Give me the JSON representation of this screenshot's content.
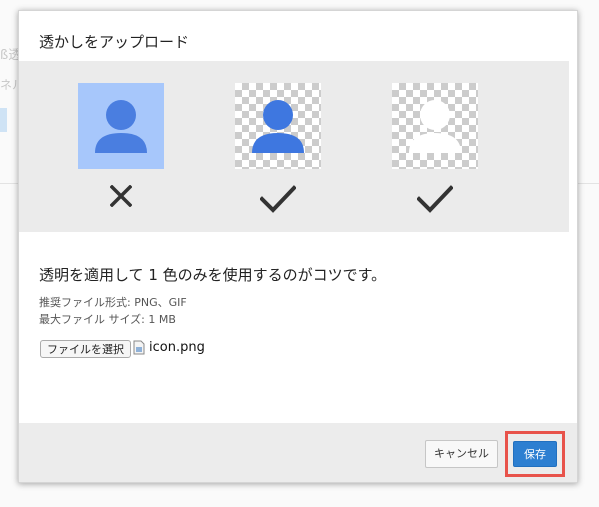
{
  "background": {
    "text_line1": "ß透",
    "text_line2": "ネル"
  },
  "dialog": {
    "title": "透かしをアップロード",
    "preview": {
      "examples": [
        {
          "style": "solid-background",
          "person_color": "#4a7ee0",
          "result": "bad",
          "result_icon": "cross-icon"
        },
        {
          "style": "transparent-background",
          "person_color": "#3e77e0",
          "result": "good",
          "result_icon": "check-icon"
        },
        {
          "style": "transparent-background",
          "person_color": "#ffffff",
          "result": "good",
          "result_icon": "check-icon"
        }
      ]
    },
    "tip": "透明を適用して 1 色のみを使用するのがコツです。",
    "recommended_formats": "推奨ファイル形式: PNG、GIF",
    "max_size": "最大ファイル サイズ: 1 MB",
    "file_picker": {
      "button_label": "ファイルを選択",
      "file_name": "icon.png"
    },
    "footer": {
      "cancel_label": "キャンセル",
      "save_label": "保存"
    }
  },
  "colors": {
    "accent": "#2d7fd1",
    "highlight": "#e8534b",
    "solid_bg": "#a7c7fb"
  }
}
